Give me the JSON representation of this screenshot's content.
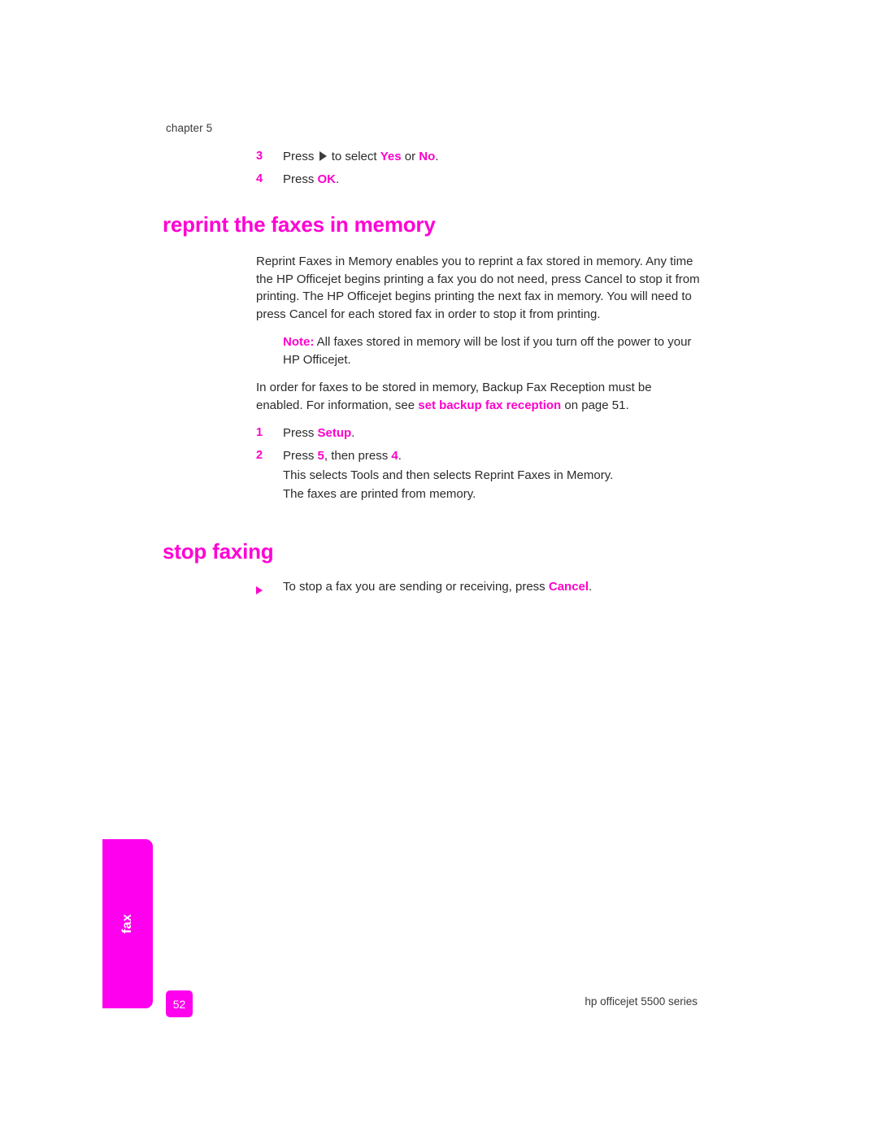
{
  "page": {
    "chapter_label": "chapter 5",
    "page_number": "52",
    "footer": "hp officejet 5500 series",
    "side_tab_label": "fax",
    "accent_color": "#ff00cc",
    "tab_color": "#ff00ee",
    "body_color": "#2b2b2b"
  },
  "top_steps": [
    {
      "number": "3",
      "text_before_arrow": "Press",
      "arrow_icon": "right-triangle-icon",
      "text_after_arrow": "to select",
      "option_one": "Yes",
      "conjunction": "or",
      "option_two": "No",
      "period": "."
    },
    {
      "number": "4",
      "text_before": "Press",
      "key": "OK",
      "period": "."
    }
  ],
  "sections": [
    {
      "heading": "reprint the faxes in memory",
      "intro_paragraph": "Reprint Faxes in Memory enables you to reprint a fax stored in memory. Any time the HP Officejet begins printing a fax you do not need, press Cancel to stop it from printing. The HP Officejet begins printing the next fax in memory. You will need to press Cancel for each stored fax in order to stop it from printing.",
      "note_label": "Note:",
      "note_text": "All faxes stored in memory will be lost if you turn off the power to your HP Officejet.",
      "xref_paragraph": {
        "before": "In order for faxes to be stored in memory, Backup Fax Reception must be enabled. For information, see",
        "link": "set backup fax reception",
        "after": "on page 51."
      },
      "steps": [
        {
          "number": "1",
          "text_before": "Press",
          "key": "Setup",
          "period": "."
        },
        {
          "number": "2",
          "text_before": "Press",
          "key_one": "5",
          "text_middle": ", then press",
          "key_two": "4",
          "period": ".",
          "extra_lines": [
            "This selects Tools and then selects Reprint Faxes in Memory.",
            "The faxes are printed from memory."
          ]
        }
      ]
    },
    {
      "heading": "stop faxing",
      "bullet": {
        "icon": "right-triangle-bullet-icon",
        "before": "To stop a fax you are sending or receiving, press",
        "key": "Cancel",
        "period": "."
      }
    }
  ]
}
